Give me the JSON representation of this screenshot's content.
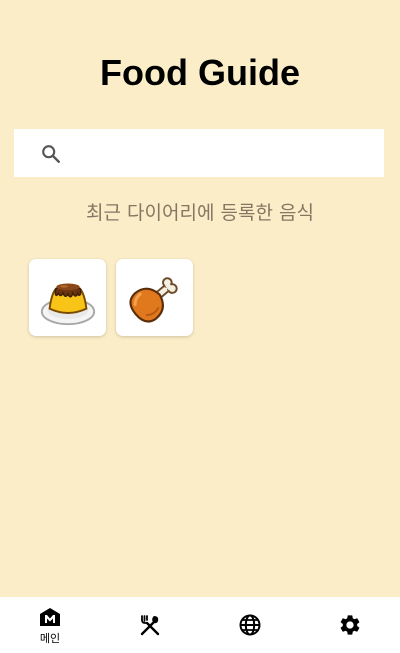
{
  "header": {
    "title": "Food Guide"
  },
  "search": {
    "placeholder": "",
    "value": ""
  },
  "recent": {
    "label": "최근 다이어리에 등록한 음식",
    "items": [
      {
        "icon": "custard-pudding-icon"
      },
      {
        "icon": "chicken-drumstick-icon"
      }
    ]
  },
  "nav": {
    "items": [
      {
        "icon": "home-icon",
        "label": "메인",
        "active": true
      },
      {
        "icon": "fork-knife-icon",
        "label": ""
      },
      {
        "icon": "globe-icon",
        "label": ""
      },
      {
        "icon": "gear-icon",
        "label": ""
      }
    ]
  },
  "colors": {
    "background": "#FBEDC7",
    "subtitle": "#857664"
  }
}
